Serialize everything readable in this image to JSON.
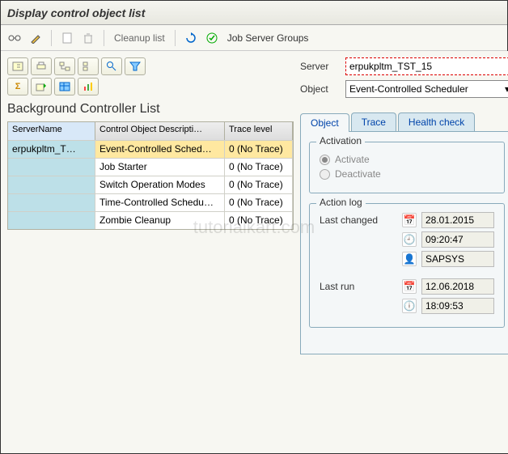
{
  "window": {
    "title": "Display control object list"
  },
  "toolbar": {
    "cleanup": "Cleanup list",
    "job_groups": "Job Server Groups"
  },
  "grid": {
    "title": "Background Controller List",
    "columns": {
      "c1": "ServerName",
      "c2": "Control Object Descripti…",
      "c3": "Trace level"
    },
    "rows": [
      {
        "server": "erpukpltm_T…",
        "desc": "Event-Controlled Sched…",
        "trace": "0 (No Trace)",
        "selected": true
      },
      {
        "server": "",
        "desc": "Job Starter",
        "trace": "0 (No Trace)"
      },
      {
        "server": "",
        "desc": "Switch Operation Modes",
        "trace": "0 (No Trace)"
      },
      {
        "server": "",
        "desc": "Time-Controlled Schedu…",
        "trace": "0 (No Trace)"
      },
      {
        "server": "",
        "desc": "Zombie Cleanup",
        "trace": "0 (No Trace)"
      }
    ]
  },
  "form": {
    "server_label": "Server",
    "server_value": "erpukpltm_TST_15",
    "object_label": "Object",
    "object_value": "Event-Controlled Scheduler"
  },
  "tabs": {
    "t1": "Object",
    "t2": "Trace",
    "t3": "Health check"
  },
  "activation": {
    "title": "Activation",
    "activate": "Activate",
    "deactivate": "Deactivate"
  },
  "actionlog": {
    "title": "Action log",
    "last_changed": "Last changed",
    "changed_date": "28.01.2015",
    "changed_time": "09:20:47",
    "changed_user": "SAPSYS",
    "last_run": "Last run",
    "run_date": "12.06.2018",
    "run_time": "18:09:53"
  },
  "watermark": "tutorialkart.com"
}
